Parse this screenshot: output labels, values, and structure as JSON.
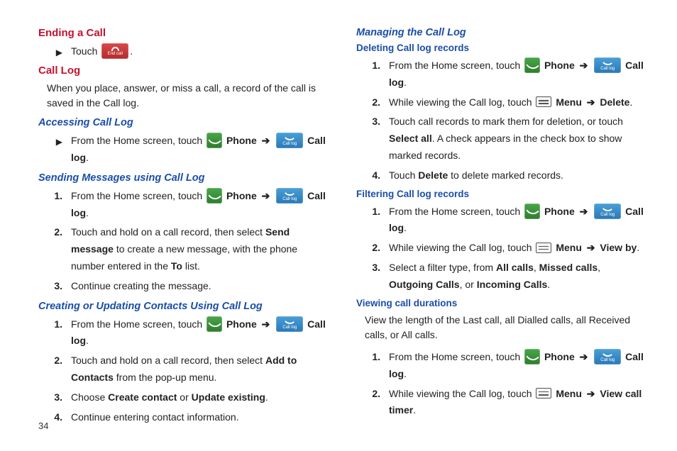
{
  "page_number": "34",
  "icons": {
    "end_label": "End call",
    "calllog_label": "Call log",
    "arrow": "➔"
  },
  "left": {
    "ending_call": {
      "title": "Ending a Call",
      "step_touch": "Touch ",
      "period": "."
    },
    "call_log": {
      "title": "Call Log",
      "intro": "When you place, answer, or miss a call, a record of the call is saved in the Call log."
    },
    "accessing": {
      "title": "Accessing Call Log",
      "from_home": "From the Home screen, touch ",
      "phone_b": "Phone",
      "calllog_b": "Call log",
      "period": "."
    },
    "sending": {
      "title": "Sending Messages using Call Log",
      "s1_a": "From the Home screen, touch ",
      "s1_phone": "Phone",
      "s1_calllog": "Call log",
      "s1_p": ".",
      "s2_a": "Touch and hold on a call record, then select ",
      "s2_b": "Send message",
      "s2_c": " to create a new message, with the phone number entered in the ",
      "s2_to": "To",
      "s2_d": " list.",
      "s3": "Continue creating the message."
    },
    "creating": {
      "title": "Creating or Updating Contacts Using Call Log",
      "s1_a": "From the Home screen, touch ",
      "s1_phone": "Phone",
      "s1_calllog": "Call log",
      "s1_p": ".",
      "s2_a": "Touch and hold on a call record, then select ",
      "s2_b": "Add to Contacts",
      "s2_c": " from the pop-up menu.",
      "s3_a": "Choose ",
      "s3_b1": "Create contact",
      "s3_or": " or ",
      "s3_b2": "Update existing",
      "s3_p": ".",
      "s4": "Continue entering contact information."
    }
  },
  "right": {
    "managing": {
      "title": "Managing the Call Log"
    },
    "deleting": {
      "title": "Deleting Call log records",
      "s1_a": "From the Home screen, touch ",
      "s1_phone": "Phone",
      "s1_calllog": "Call log",
      "s1_p": ".",
      "s2_a": "While viewing the Call log, touch ",
      "s2_menu": "Menu",
      "s2_del": "Delete",
      "s2_p": ".",
      "s3_a": "Touch call records to mark them for deletion, or touch ",
      "s3_b": "Select all",
      "s3_c": ". A check appears in the check box to show marked records.",
      "s4_a": "Touch ",
      "s4_b": "Delete",
      "s4_c": " to delete marked records."
    },
    "filtering": {
      "title": "Filtering Call log records",
      "s1_a": "From the Home screen, touch ",
      "s1_phone": "Phone",
      "s1_calllog": "Call log",
      "s1_p": ".",
      "s2_a": "While viewing the Call log, touch ",
      "s2_menu": "Menu",
      "s2_view": "View by",
      "s2_p": ".",
      "s3_a": "Select a filter type, from ",
      "s3_b1": "All calls",
      "s3_c1": ", ",
      "s3_b2": "Missed calls",
      "s3_c2": ", ",
      "s3_b3": "Outgoing Calls",
      "s3_c3": ", or ",
      "s3_b4": "Incoming Calls",
      "s3_p": "."
    },
    "durations": {
      "title": "Viewing call durations",
      "intro": "View the length of the Last call, all Dialled calls, all Received calls, or All calls.",
      "s1_a": "From the Home screen, touch ",
      "s1_phone": "Phone",
      "s1_calllog": "Call log",
      "s1_p": ".",
      "s2_a": "While viewing the Call log, touch ",
      "s2_menu": "Menu",
      "s2_vct": "View call timer",
      "s2_p": "."
    }
  }
}
